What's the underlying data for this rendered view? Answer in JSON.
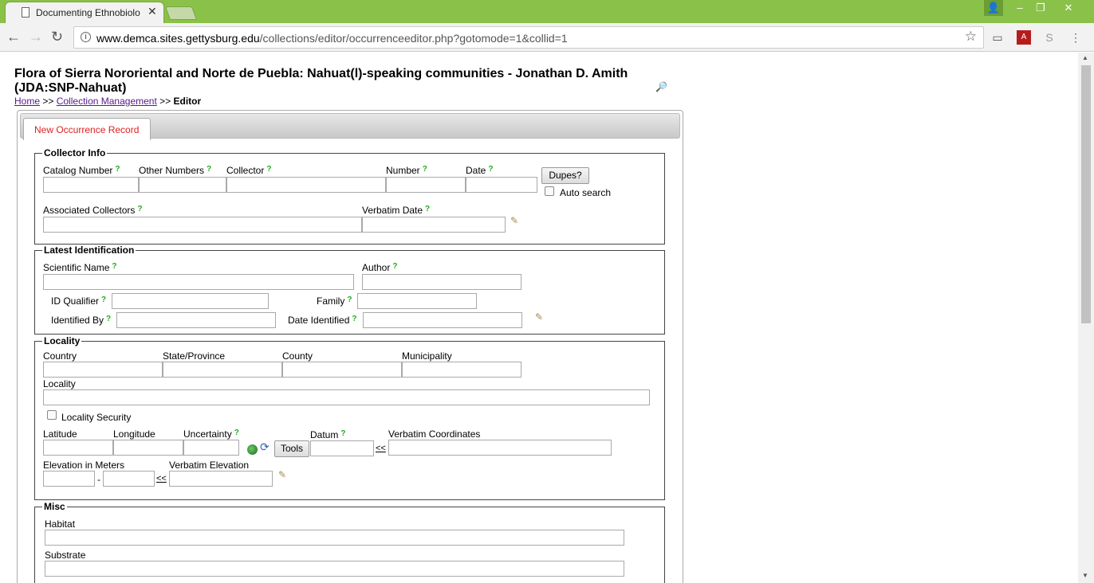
{
  "browser": {
    "tab_title": "Documenting Ethnobiolo",
    "url_host": "www.demca.sites.gettysburg.edu",
    "url_path": "/collections/editor/occurrenceeditor.php?gotomode=1&collid=1"
  },
  "header": {
    "title": "Flora of Sierra Nororiental and Norte de Puebla: Nahuat(l)-speaking communities - Jonathan D. Amith (JDA:SNP-Nahuat)",
    "breadcrumb": {
      "home": "Home",
      "sep1": ">>",
      "collection_management": "Collection Management",
      "sep2": ">>",
      "current": "Editor"
    }
  },
  "tabs": {
    "new_record": "New Occurrence Record"
  },
  "collector_info": {
    "legend": "Collector Info",
    "catalog_number": "Catalog Number",
    "other_numbers": "Other Numbers",
    "collector": "Collector",
    "number": "Number",
    "date": "Date",
    "dupes_button": "Dupes?",
    "auto_search": "Auto search",
    "associated_collectors": "Associated Collectors",
    "verbatim_date": "Verbatim Date"
  },
  "latest_identification": {
    "legend": "Latest Identification",
    "scientific_name": "Scientific Name",
    "author": "Author",
    "id_qualifier": "ID Qualifier",
    "family": "Family",
    "identified_by": "Identified By",
    "date_identified": "Date Identified"
  },
  "locality": {
    "legend": "Locality",
    "country": "Country",
    "state_province": "State/Province",
    "county": "County",
    "municipality": "Municipality",
    "locality": "Locality",
    "locality_security": "Locality Security",
    "latitude": "Latitude",
    "longitude": "Longitude",
    "uncertainty": "Uncertainty",
    "tools_button": "Tools",
    "datum": "Datum",
    "copy_link": "<<",
    "verbatim_coordinates": "Verbatim Coordinates",
    "elevation": "Elevation in Meters",
    "elevation_sep": "-",
    "elev_copy_link": "<<",
    "verbatim_elevation": "Verbatim Elevation"
  },
  "misc": {
    "legend": "Misc",
    "habitat": "Habitat",
    "substrate": "Substrate"
  },
  "help_mark": "?"
}
